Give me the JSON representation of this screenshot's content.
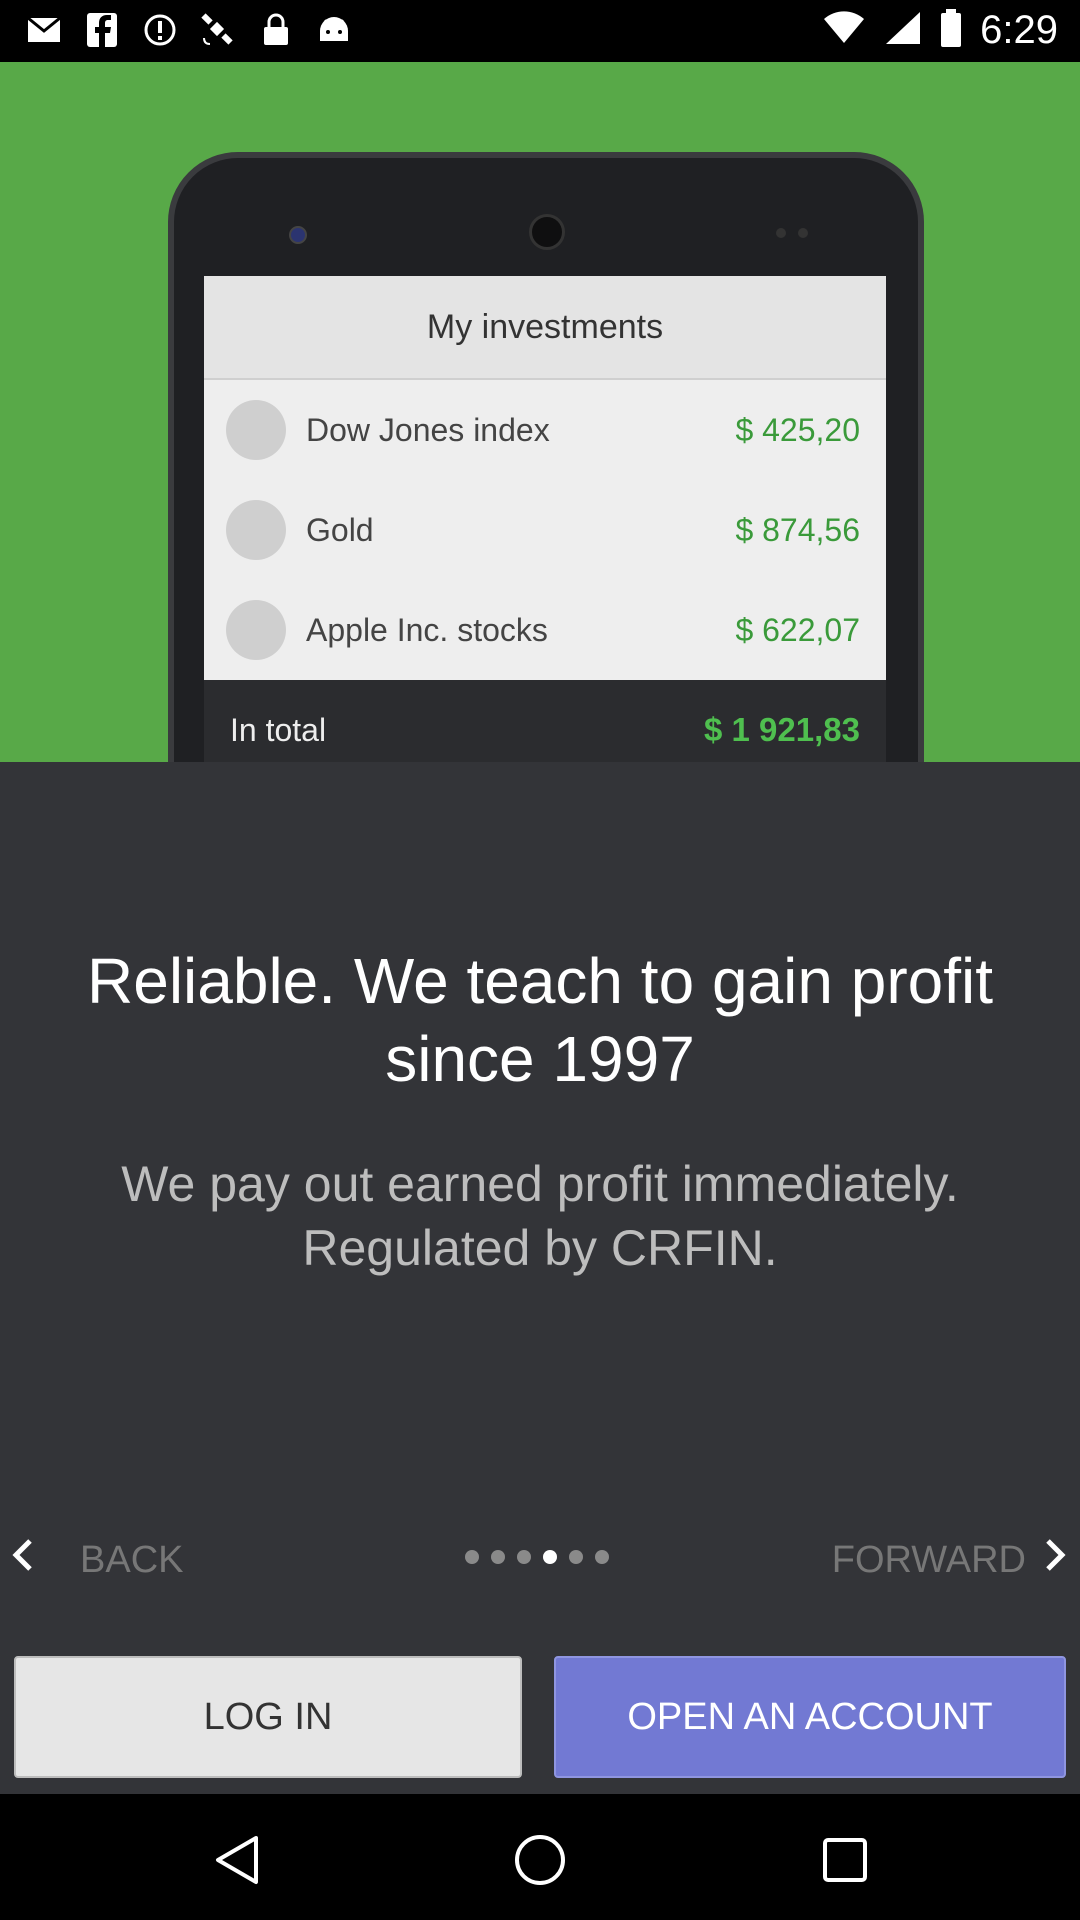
{
  "status_bar": {
    "time": "6:29",
    "left_icons": [
      "mail-icon",
      "facebook-icon",
      "alert-icon",
      "satellite-icon",
      "lock-icon",
      "android-icon"
    ],
    "right_icons": [
      "wifi-icon",
      "signal-icon",
      "battery-icon"
    ]
  },
  "hero": {
    "phone_screen_title": "My investments",
    "investments": [
      {
        "name": "Dow Jones index",
        "value": "$ 425,20"
      },
      {
        "name": "Gold",
        "value": "$ 874,56"
      },
      {
        "name": "Apple Inc. stocks",
        "value": "$ 622,07"
      }
    ],
    "total_label": "In total",
    "total_value": "$ 1 921,83",
    "background_color": "#58a948"
  },
  "content": {
    "headline": "Reliable. We teach to gain profit since 1997",
    "subline": "We pay out earned profit immediately. Regulated by CRFIN."
  },
  "navigation": {
    "back_label": "BACK",
    "forward_label": "FORWARD",
    "pager": {
      "count": 6,
      "active_index": 3
    }
  },
  "buttons": {
    "login_label": "LOG IN",
    "open_account_label": "OPEN AN ACCOUNT",
    "accent_color": "#7279d3"
  },
  "system_nav": [
    "back-triangle-icon",
    "home-circle-icon",
    "recents-square-icon"
  ]
}
